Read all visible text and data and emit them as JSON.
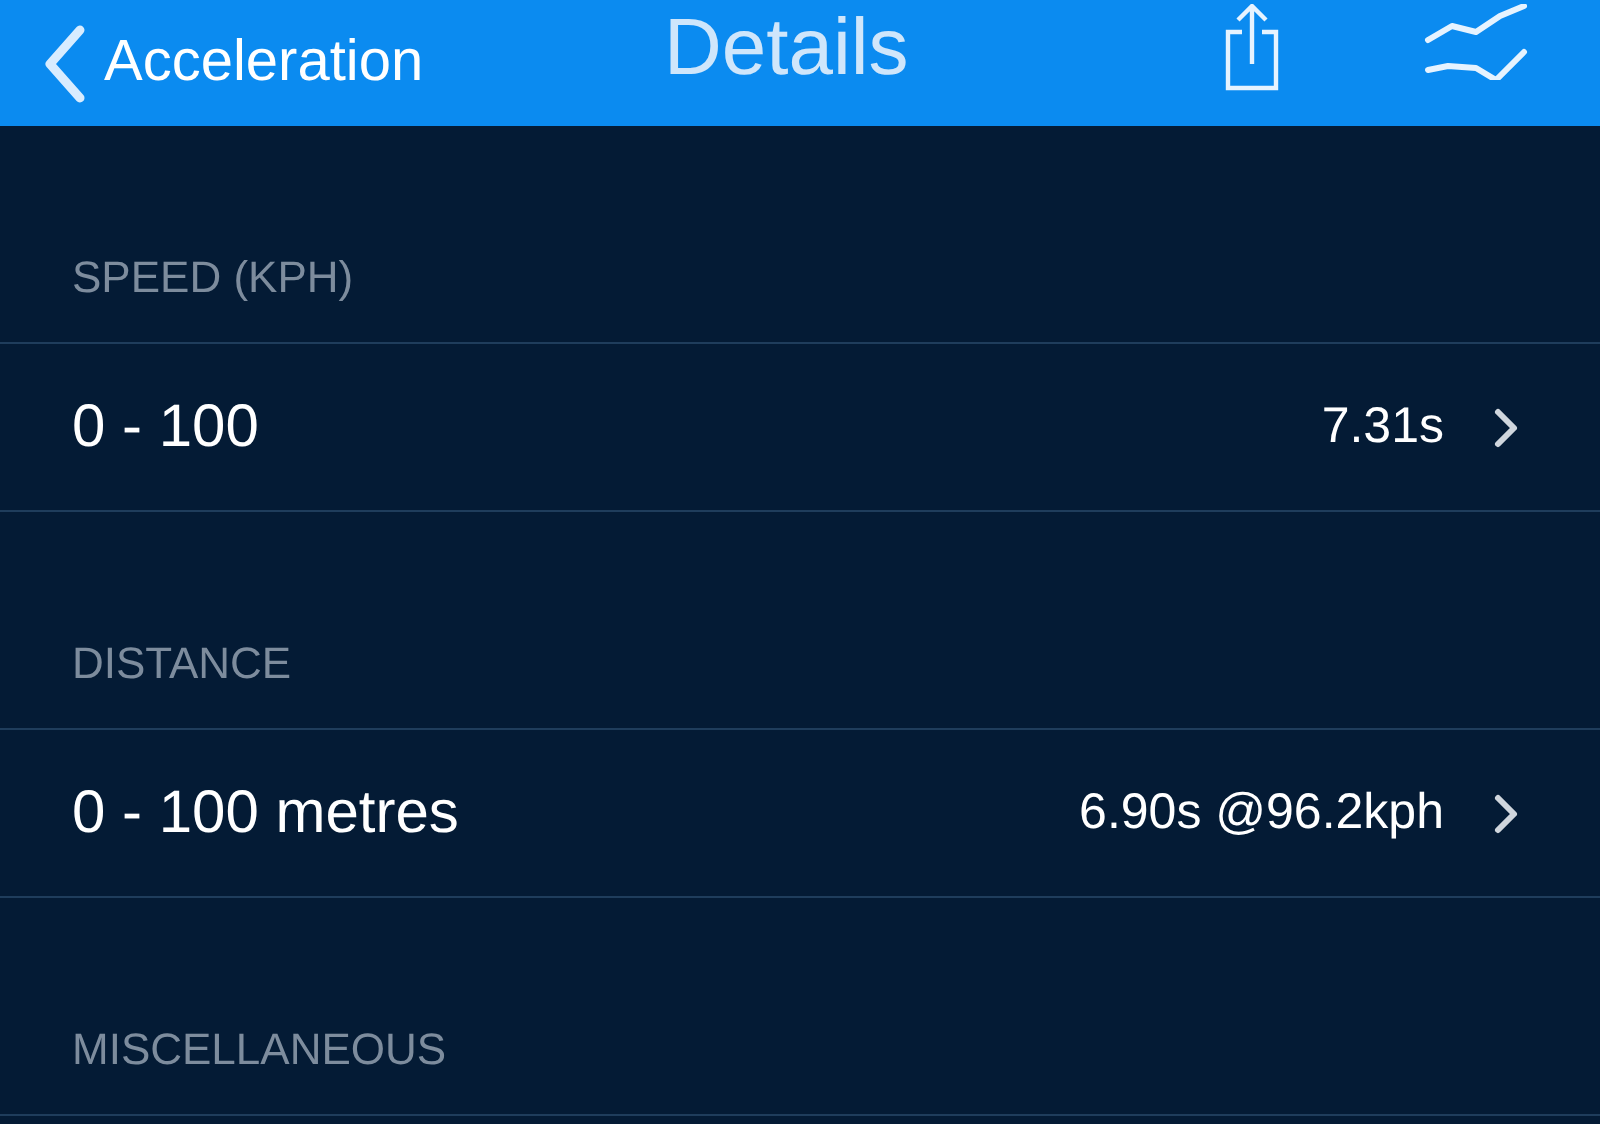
{
  "nav": {
    "back_label": "Acceleration",
    "title": "Details"
  },
  "sections": [
    {
      "header": "SPEED (KPH)",
      "rows": [
        {
          "label": "0 - 100",
          "value": "7.31s"
        }
      ]
    },
    {
      "header": "DISTANCE",
      "rows": [
        {
          "label": "0 - 100 metres",
          "value": "6.90s @96.2kph"
        }
      ]
    },
    {
      "header": "MISCELLANEOUS"
    }
  ]
}
